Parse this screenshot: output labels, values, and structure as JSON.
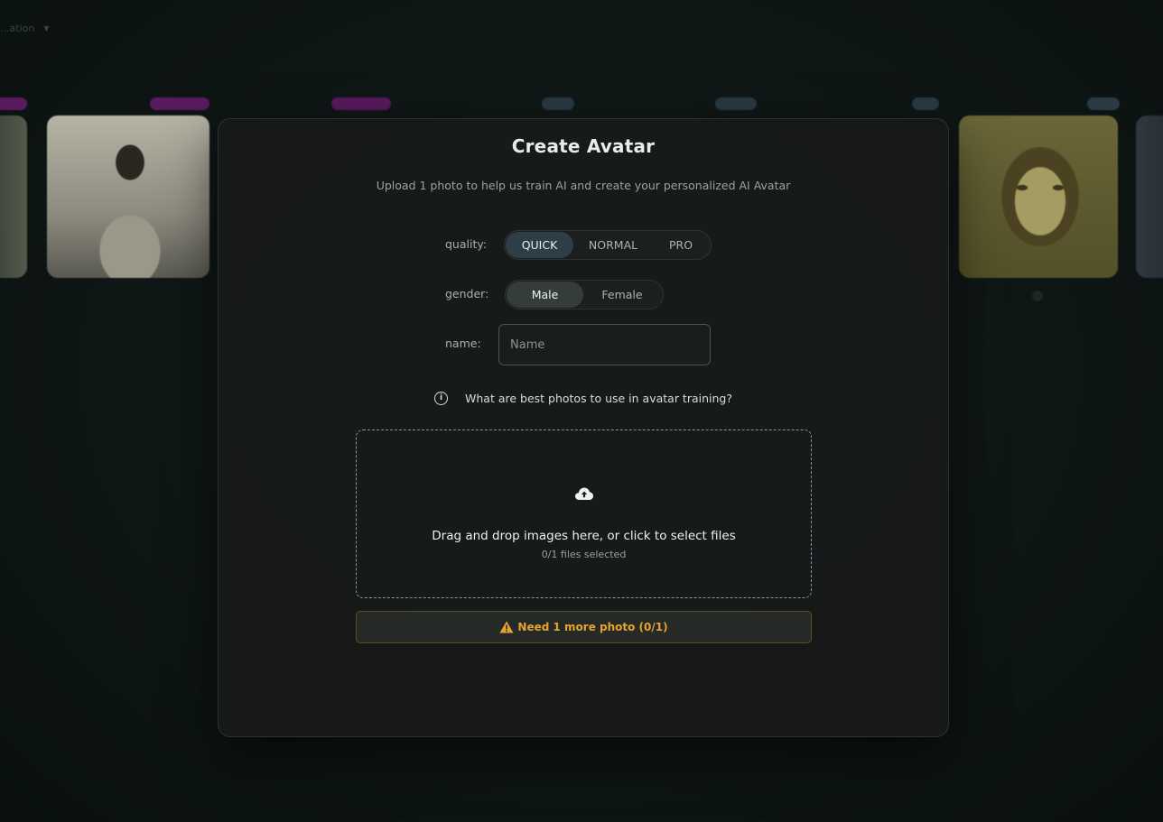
{
  "background": {
    "topbar_text": "...ation",
    "tags": [
      {
        "color": "#5a1a5e"
      },
      {
        "color": "#5a1a5e"
      },
      {
        "color": "#5a1a5e"
      },
      {
        "color": "#2a3a44"
      },
      {
        "color": "#2a3a44"
      },
      {
        "color": "#2a3a44"
      },
      {
        "color": "#2a3a44"
      }
    ]
  },
  "modal": {
    "title": "Create Avatar",
    "subtitle": "Upload 1 photo to help us train AI and create your personalized AI Avatar",
    "quality": {
      "label": "quality:",
      "options": [
        "QUICK",
        "NORMAL",
        "PRO"
      ],
      "selected": "QUICK"
    },
    "gender": {
      "label": "gender:",
      "options": [
        "Male",
        "Female"
      ],
      "selected": "Male"
    },
    "name": {
      "label": "name:",
      "placeholder": "Name",
      "value": ""
    },
    "help_link": {
      "icon": "info-icon",
      "text": "What are best photos to use in avatar training?"
    },
    "dropzone": {
      "icon": "cloud-upload-icon",
      "text": "Drag and drop images here, or click to select files",
      "count_text": "0/1 files selected"
    },
    "warning": {
      "icon": "warning-triangle-icon",
      "text": "Need 1 more photo (0/1)",
      "color": "#e6a230"
    }
  }
}
